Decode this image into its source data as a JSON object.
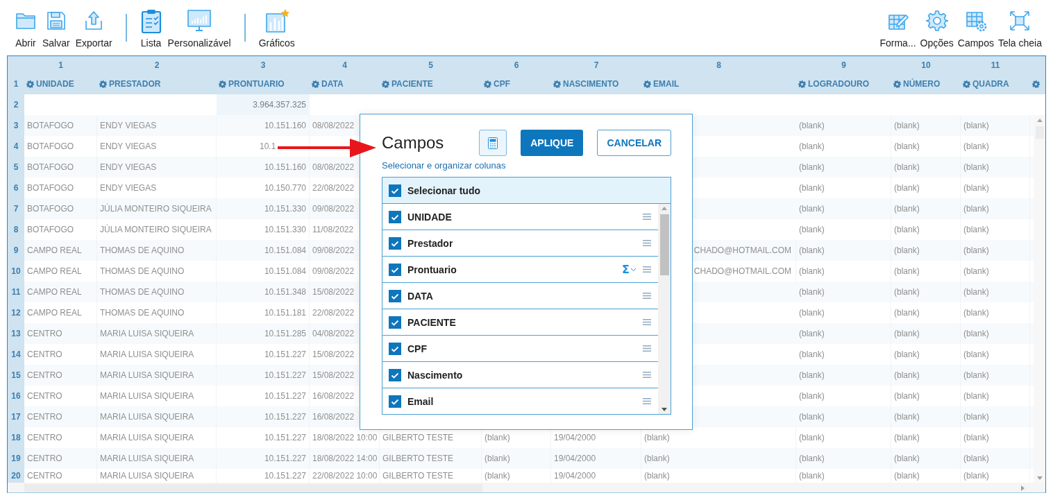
{
  "toolbar": {
    "left_groups": [
      [
        {
          "label": "Abrir"
        },
        {
          "label": "Salvar"
        },
        {
          "label": "Exportar"
        }
      ],
      [
        {
          "label": "Lista"
        },
        {
          "label": "Personalizável"
        }
      ],
      [
        {
          "label": "Gráficos"
        }
      ]
    ],
    "right": [
      {
        "label": "Forma..."
      },
      {
        "label": "Opções"
      },
      {
        "label": "Campos"
      },
      {
        "label": "Tela cheia"
      }
    ]
  },
  "grid": {
    "columns": [
      {
        "number": "1",
        "header": "UNIDADE"
      },
      {
        "number": "2",
        "header": "PRESTADOR"
      },
      {
        "number": "3",
        "header": "PRONTUARIO"
      },
      {
        "number": "4",
        "header": "DATA"
      },
      {
        "number": "5",
        "header": "PACIENTE"
      },
      {
        "number": "6",
        "header": "CPF"
      },
      {
        "number": "7",
        "header": "NASCIMENTO"
      },
      {
        "number": "8",
        "header": "EMAIL"
      },
      {
        "number": "9",
        "header": "LOGRADOURO"
      },
      {
        "number": "10",
        "header": "NÚMERO"
      },
      {
        "number": "11",
        "header": "QUADRA"
      }
    ],
    "header_row_number": "1",
    "rows": [
      {
        "number": "2",
        "total": "3.964.357.325"
      },
      {
        "number": "3",
        "cells": [
          "BOTAFOGO",
          "ENDY VIEGAS",
          "10.151.160",
          "08/08/2022"
        ],
        "tail": [
          "(blank)",
          "(blank)",
          "(blank)"
        ]
      },
      {
        "number": "4",
        "cells": [
          "BOTAFOGO",
          "ENDY VIEGAS",
          "10.1"
        ],
        "tail": [
          "(blank)",
          "(blank)",
          "(blank)"
        ]
      },
      {
        "number": "5",
        "cells": [
          "BOTAFOGO",
          "ENDY VIEGAS",
          "10.151.160",
          "08/08/2022"
        ],
        "tail": [
          "(blank)",
          "(blank)",
          "(blank)"
        ]
      },
      {
        "number": "6",
        "cells": [
          "BOTAFOGO",
          "ENDY VIEGAS",
          "10.150.770",
          "22/08/2022"
        ],
        "tail": [
          "(blank)",
          "(blank)",
          "(blank)"
        ]
      },
      {
        "number": "7",
        "cells": [
          "BOTAFOGO",
          "JÚLIA MONTEIRO SIQUEIRA",
          "10.151.330",
          "09/08/2022"
        ],
        "tail": [
          "(blank)",
          "(blank)",
          "(blank)"
        ]
      },
      {
        "number": "8",
        "cells": [
          "BOTAFOGO",
          "JÚLIA MONTEIRO SIQUEIRA",
          "10.151.330",
          "11/08/2022"
        ],
        "tail": [
          "(blank)",
          "(blank)",
          "(blank)"
        ]
      },
      {
        "number": "9",
        "cells": [
          "CAMPO REAL",
          "THOMAS DE AQUINO",
          "10.151.084",
          "09/08/2022"
        ],
        "email": "CHADO@HOTMAIL.COM",
        "tail": [
          "(blank)",
          "(blank)",
          "(blank)"
        ]
      },
      {
        "number": "10",
        "cells": [
          "CAMPO REAL",
          "THOMAS DE AQUINO",
          "10.151.084",
          "09/08/2022"
        ],
        "email": "CHADO@HOTMAIL.COM",
        "tail": [
          "(blank)",
          "(blank)",
          "(blank)"
        ]
      },
      {
        "number": "11",
        "cells": [
          "CAMPO REAL",
          "THOMAS DE AQUINO",
          "10.151.348",
          "15/08/2022"
        ],
        "tail": [
          "(blank)",
          "(blank)",
          "(blank)"
        ]
      },
      {
        "number": "12",
        "cells": [
          "CAMPO REAL",
          "THOMAS DE AQUINO",
          "10.151.181",
          "22/08/2022"
        ],
        "tail": [
          "(blank)",
          "(blank)",
          "(blank)"
        ]
      },
      {
        "number": "13",
        "cells": [
          "CENTRO",
          "MARIA LUISA SIQUEIRA",
          "10.151.285",
          "04/08/2022"
        ],
        "tail": [
          "(blank)",
          "(blank)",
          "(blank)"
        ]
      },
      {
        "number": "14",
        "cells": [
          "CENTRO",
          "MARIA LUISA SIQUEIRA",
          "10.151.227",
          "15/08/2022"
        ],
        "tail": [
          "(blank)",
          "(blank)",
          "(blank)"
        ]
      },
      {
        "number": "15",
        "cells": [
          "CENTRO",
          "MARIA LUISA SIQUEIRA",
          "10.151.227",
          "15/08/2022"
        ],
        "tail": [
          "(blank)",
          "(blank)",
          "(blank)"
        ]
      },
      {
        "number": "16",
        "cells": [
          "CENTRO",
          "MARIA LUISA SIQUEIRA",
          "10.151.227",
          "16/08/2022"
        ],
        "tail": [
          "(blank)",
          "(blank)",
          "(blank)"
        ]
      },
      {
        "number": "17",
        "cells": [
          "CENTRO",
          "MARIA LUISA SIQUEIRA",
          "10.151.227",
          "16/08/2022"
        ],
        "tail": [
          "(blank)",
          "(blank)",
          "(blank)"
        ]
      },
      {
        "number": "18",
        "cells": [
          "CENTRO",
          "MARIA LUISA SIQUEIRA",
          "10.151.227",
          "18/08/2022 10:00",
          "GILBERTO TESTE",
          "(blank)",
          "19/04/2000",
          "(blank)",
          "(blank)",
          "(blank)",
          "(blank)"
        ]
      },
      {
        "number": "19",
        "cells": [
          "CENTRO",
          "MARIA LUISA SIQUEIRA",
          "10.151.227",
          "18/08/2022 14:00",
          "GILBERTO TESTE",
          "(blank)",
          "19/04/2000",
          "(blank)",
          "(blank)",
          "(blank)",
          "(blank)"
        ]
      },
      {
        "number": "20",
        "cells": [
          "CENTRO",
          "MARIA LUISA SIQUEIRA",
          "10.151.227",
          "22/08/2022 10:00",
          "GILBERTO TESTE",
          "(blank)",
          "19/04/2000",
          "(blank)",
          "(blank)",
          "(blank)",
          "(blank)"
        ]
      }
    ]
  },
  "dialog": {
    "title": "Campos",
    "apply": "APLIQUE",
    "cancel": "CANCELAR",
    "subtitle": "Selecionar e organizar colunas",
    "select_all": {
      "label": "Selecionar tudo",
      "checked": true
    },
    "items": [
      {
        "label": "UNIDADE",
        "checked": true
      },
      {
        "label": "Prestador",
        "checked": true
      },
      {
        "label": "Prontuario",
        "checked": true,
        "aggregate": "Σ"
      },
      {
        "label": "DATA",
        "checked": true
      },
      {
        "label": "PACIENTE",
        "checked": true
      },
      {
        "label": "CPF",
        "checked": true
      },
      {
        "label": "Nascimento",
        "checked": true
      },
      {
        "label": "Email",
        "checked": true
      }
    ]
  }
}
